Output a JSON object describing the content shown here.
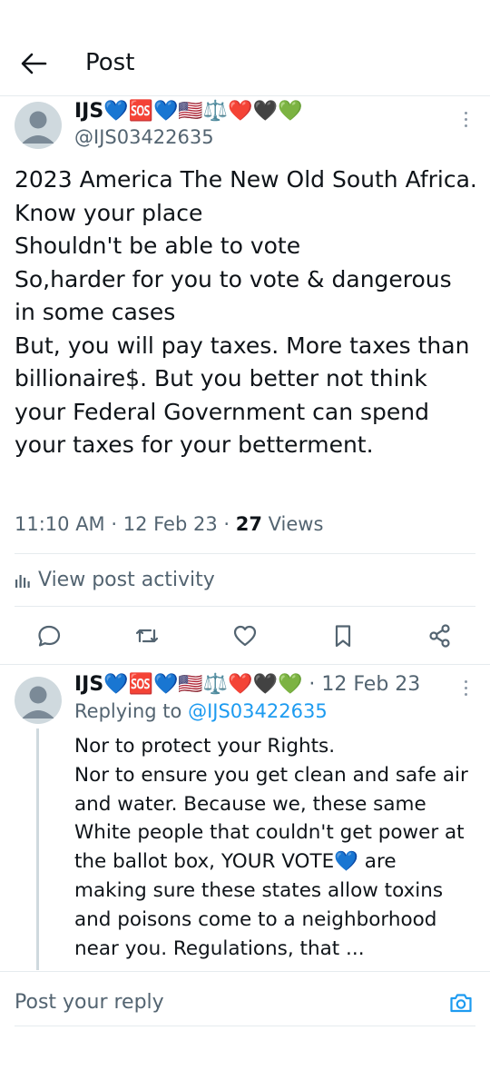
{
  "header": {
    "title": "Post"
  },
  "post": {
    "display_name": "IJS💙🆘💙🇺🇸⚖️❤️🖤💚",
    "handle": "@IJS03422635",
    "text": "2023 America The New Old South Africa.\nKnow your place\nShouldn't be able to vote\nSo,harder for you to vote & dangerous in some cases\nBut, you will pay taxes. More taxes than billionaire$. But you better not think your Federal Government can spend your taxes for your betterment.",
    "time": "11:10 AM · 12 Feb 23 · ",
    "views_count": "27",
    "views_label": " Views",
    "activity_label": "View post activity"
  },
  "actions": [
    {
      "icon": "reply-icon"
    },
    {
      "icon": "repost-icon"
    },
    {
      "icon": "like-icon"
    },
    {
      "icon": "bookmark-icon"
    },
    {
      "icon": "share-icon"
    }
  ],
  "reply": {
    "display_name": "IJS💙🆘💙🇺🇸⚖️❤️🖤💚",
    "date": " · 12 Feb 23",
    "replying_prefix": "Replying to ",
    "replying_handle": "@IJS03422635",
    "text": "Nor to protect your Rights.\nNor to ensure you get clean and safe air and water. Because we, these same White people that couldn't get power at the ballot box, YOUR VOTE💙 are making sure these states allow toxins and poisons come to a neighborhood near you. Regulations, that ..."
  },
  "composer": {
    "placeholder": "Post your reply"
  },
  "colors": {
    "accent": "#1d9bf0",
    "secondary_text": "#536471",
    "divider": "#e6ebee"
  }
}
